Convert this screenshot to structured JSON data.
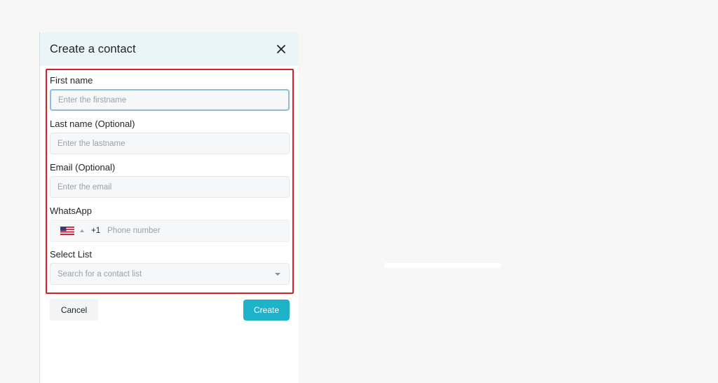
{
  "modal": {
    "title": "Create a contact",
    "close_icon": "close-icon"
  },
  "form": {
    "first_name": {
      "label": "First name",
      "placeholder": "Enter the firstname",
      "value": ""
    },
    "last_name": {
      "label": "Last name (Optional)",
      "placeholder": "Enter the lastname",
      "value": ""
    },
    "email": {
      "label": "Email (Optional)",
      "placeholder": "Enter the email",
      "value": ""
    },
    "whatsapp": {
      "label": "WhatsApp",
      "country_flag_icon": "us-flag-icon",
      "dial_code": "+1",
      "placeholder": "Phone number",
      "value": ""
    },
    "select_list": {
      "label": "Select List",
      "placeholder": "Search for a contact list",
      "dropdown_icon": "chevron-down-icon"
    }
  },
  "actions": {
    "cancel_label": "Cancel",
    "create_label": "Create"
  },
  "colors": {
    "header_bg": "#eaf5f8",
    "primary": "#1fb3c9",
    "highlight": "#d81f26",
    "focus_border": "#8fbcd8"
  }
}
